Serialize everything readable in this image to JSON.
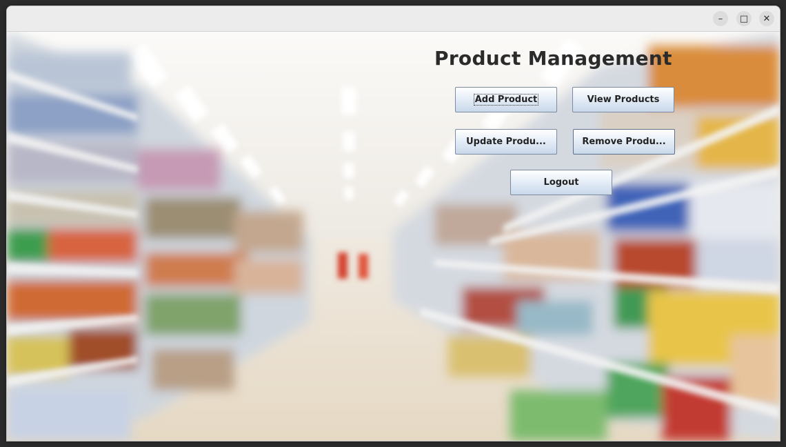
{
  "window": {
    "controls": {
      "minimize": "–",
      "maximize": "□",
      "close": "✕"
    }
  },
  "main": {
    "title": "Product Management",
    "buttons": {
      "add": "Add Product",
      "view": "View Products",
      "update": "Update Produ...",
      "remove": "Remove Produ...",
      "logout": "Logout"
    }
  },
  "background": {
    "description_icon": "supermarket-aisle-image"
  },
  "colors": {
    "button_top": "#ffffff",
    "button_bottom": "#c9d8ea",
    "button_border": "#7a8aa0",
    "title_text": "#2b2b2b"
  }
}
